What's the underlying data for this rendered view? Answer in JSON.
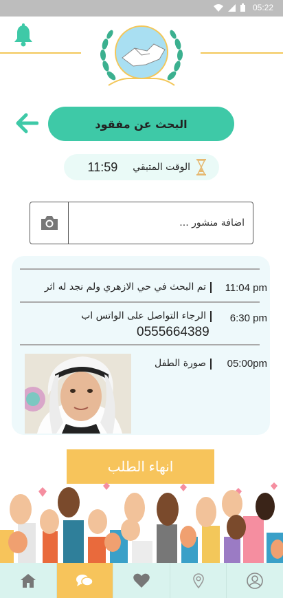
{
  "status_bar": {
    "time": "05:22"
  },
  "page": {
    "title": "البحث عن مفقود",
    "timer_label": "الوقت المتبقي",
    "timer_value": "11:59"
  },
  "post_input": {
    "placeholder": "اضافة منشور ..."
  },
  "timeline": [
    {
      "time": "11:04 pm",
      "text": "تم البحث في حي الازهري ولم نجد له اثر"
    },
    {
      "time": "6:30 pm",
      "text": "الرجاء التواصل على الواتس اب",
      "phone": "0555664389"
    },
    {
      "time": "05:00pm",
      "text": "صورة الطفل"
    }
  ],
  "end_button": {
    "label": "انهاء الطلب"
  },
  "bottom_nav": {
    "items": [
      {
        "icon": "home-icon"
      },
      {
        "icon": "chat-icon",
        "active": true
      },
      {
        "icon": "heart-icon"
      },
      {
        "icon": "location-pin-icon"
      },
      {
        "icon": "profile-icon"
      }
    ]
  },
  "colors": {
    "primary": "#3ec9a7",
    "accent": "#f7c45b",
    "timeline_bg": "#eef9fb",
    "nav_bg": "#d9f3ee",
    "status_bar": "#bdbdbd"
  }
}
